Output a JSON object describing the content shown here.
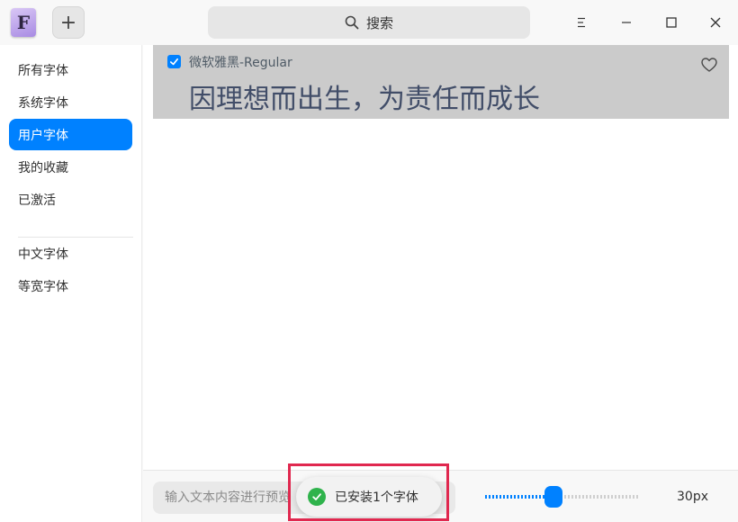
{
  "titlebar": {
    "app_icon_letter": "F",
    "add_label": "+",
    "search_label": "搜索"
  },
  "sidebar": {
    "items": [
      {
        "label": "所有字体"
      },
      {
        "label": "系统字体"
      },
      {
        "label": "用户字体",
        "active": true
      },
      {
        "label": "我的收藏"
      },
      {
        "label": "已激活"
      }
    ],
    "groups": [
      {
        "label": "中文字体"
      },
      {
        "label": "等宽字体"
      }
    ]
  },
  "font_list": [
    {
      "name": "微软雅黑-Regular",
      "preview": "因理想而出生，为责任而成长",
      "checked": true
    }
  ],
  "bottombar": {
    "preview_placeholder": "输入文本内容进行预览",
    "font_size_label": "30px",
    "font_size_slider_fraction": 0.44
  },
  "toast": {
    "message": "已安装1个字体"
  },
  "colors": {
    "accent": "#0081ff",
    "success": "#2fb34c",
    "highlight": "#e0284f"
  }
}
